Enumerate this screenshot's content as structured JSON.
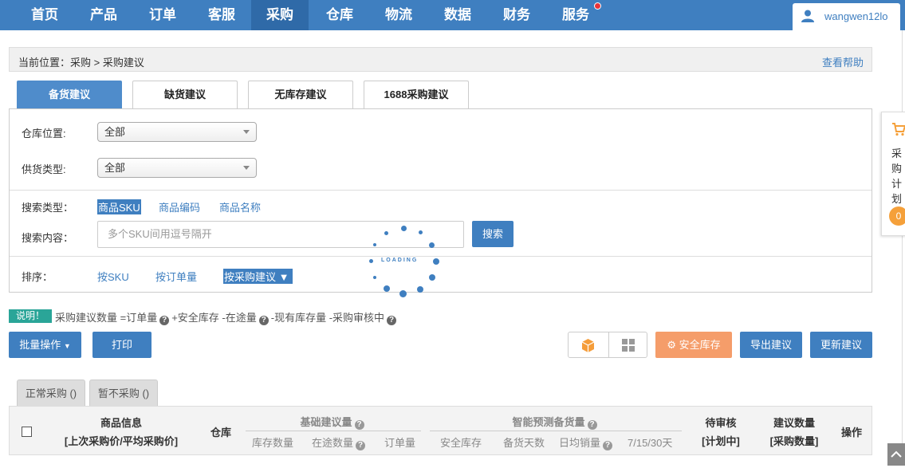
{
  "nav": {
    "items": [
      "首页",
      "产品",
      "订单",
      "客服",
      "采购",
      "仓库",
      "物流",
      "数据",
      "财务",
      "服务"
    ],
    "active_index": 4,
    "user": "wangwen12lo"
  },
  "breadcrumb": {
    "text": "当前位置：采购 > 采购建议",
    "help": "查看帮助"
  },
  "tabs": [
    "备货建议",
    "缺货建议",
    "无库存建议",
    "1688采购建议"
  ],
  "filters": {
    "warehouse_label": "仓库位置:",
    "warehouse_value": "全部",
    "supply_label": "供货类型:",
    "supply_value": "全部",
    "search_type_label": "搜索类型：",
    "search_types": [
      "商品SKU",
      "商品编码",
      "商品名称"
    ],
    "search_content_label": "搜索内容：",
    "search_placeholder": "多个SKU间用逗号隔开",
    "search_button": "搜索",
    "sort_label": "排序：",
    "sort_options": [
      "按SKU",
      "按订单量",
      "按采购建议"
    ]
  },
  "loading_text": "LOADING",
  "notice": {
    "tag": "说明！",
    "p1": "采购建议数量 =订单量",
    "p2": "+安全库存 -在途量",
    "p3": "-现有库存量 -采购审核中"
  },
  "actions": {
    "batch": "批量操作",
    "print": "打印",
    "safety_stock": "安全库存",
    "export": "导出建议",
    "update": "更新建议"
  },
  "subtabs": [
    "正常采购 ()",
    "暂不采购 ()"
  ],
  "table": {
    "product_info": "商品信息",
    "product_info_sub": "[上次采购价/平均采购价]",
    "warehouse": "仓库",
    "basic_group": "基础建议量",
    "basic_cols": [
      "库存数量",
      "在途数量",
      "订单量"
    ],
    "smart_group": "智能预测备货量",
    "smart_cols": [
      "安全库存",
      "备货天数",
      "日均销量",
      "7/15/30天"
    ],
    "pending": "待审核",
    "pending_sub": "[计划中]",
    "suggest": "建议数量",
    "suggest_sub": "[采购数量]",
    "operation": "操作"
  },
  "float": {
    "text": "采购计划",
    "badge": "0"
  },
  "colors": {
    "nav": "#3f7fc0",
    "accent": "#4f8ccb",
    "orange": "#f59d6a",
    "notice": "#2aa598"
  }
}
